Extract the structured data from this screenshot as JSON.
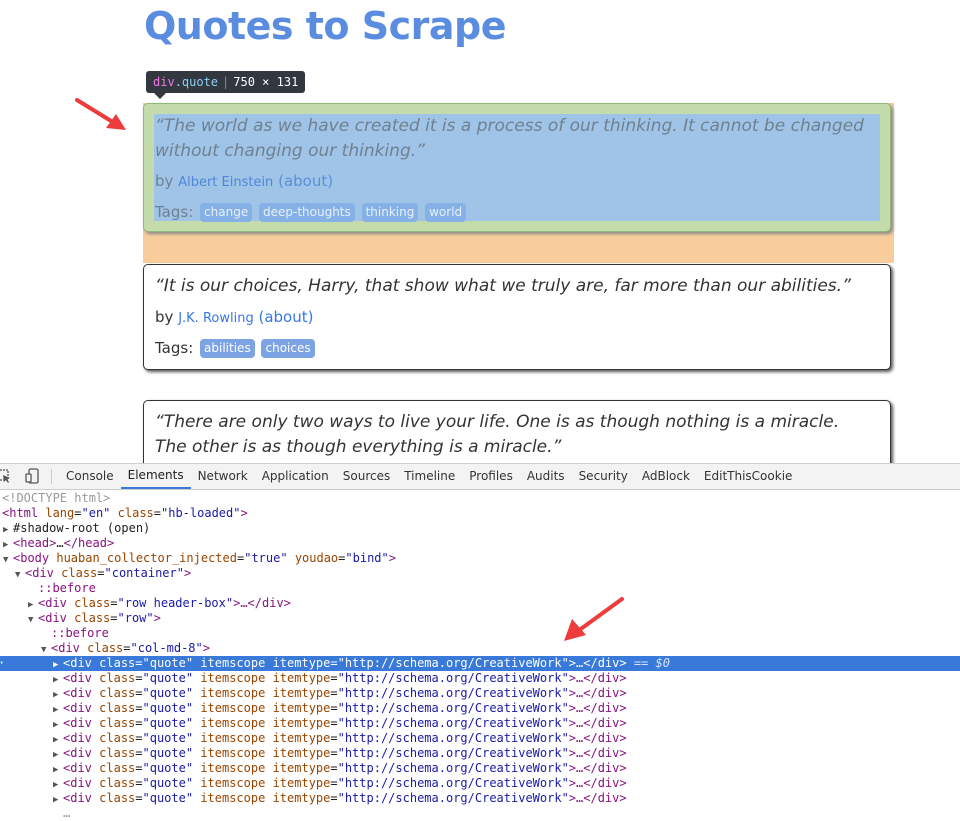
{
  "page": {
    "title": "Quotes to Scrape",
    "inspect_tooltip": {
      "tag": "div",
      "class": ".quote",
      "size": "750 × 131"
    },
    "quotes": [
      {
        "text": "“The world as we have created it is a process of our thinking. It cannot be changed without changing our thinking.”",
        "by": "by",
        "author": "Albert Einstein",
        "about": "(about)",
        "tags_label": "Tags:",
        "tags": [
          "change",
          "deep-thoughts",
          "thinking",
          "world"
        ]
      },
      {
        "text": "“It is our choices, Harry, that show what we truly are, far more than our abilities.”",
        "by": "by",
        "author": "J.K. Rowling",
        "about": "(about)",
        "tags_label": "Tags:",
        "tags": [
          "abilities",
          "choices"
        ]
      },
      {
        "text": "“There are only two ways to live your life. One is as though nothing is a miracle. The other is as though everything is a miracle.”"
      }
    ]
  },
  "devtools": {
    "tabs": [
      "Console",
      "Elements",
      "Network",
      "Application",
      "Sources",
      "Timeline",
      "Profiles",
      "Audits",
      "Security",
      "AdBlock",
      "EditThisCookie"
    ],
    "active_tab": "Elements",
    "dom": {
      "doctype": "<!DOCTYPE html>",
      "html_open": {
        "tag": "<html",
        "a1": "lang",
        "v1": "\"en\"",
        "a2": "class",
        "v2": "\"hb-loaded\"",
        "end": ">"
      },
      "shadow_root": "#shadow-root (open)",
      "head": {
        "open": "<head>",
        "ellipsis": "…",
        "close": "</head>"
      },
      "body_open": {
        "tag": "<body",
        "a1": "huaban_collector_injected",
        "v1": "\"true\"",
        "a2": "youdao",
        "v2": "\"bind\"",
        "end": ">"
      },
      "container": {
        "tag": "<div",
        "a": "class",
        "v": "\"container\"",
        "end": ">"
      },
      "before": "::before",
      "header_row": {
        "tag": "<div",
        "a": "class",
        "v": "\"row header-box\"",
        "end": ">…</div>"
      },
      "row": {
        "tag": "<div",
        "a": "class",
        "v": "\"row\"",
        "end": ">"
      },
      "col": {
        "tag": "<div",
        "a": "class",
        "v": "\"col-md-8\"",
        "end": ">"
      },
      "quote_div": {
        "tag": "<div",
        "a1": "class",
        "v1": "\"quote\"",
        "a2": "itemscope",
        "a3": "itemtype",
        "v3": "\"http://schema.org/CreativeWork\"",
        "end": ">…</div>"
      },
      "selected_marker": "== $0",
      "partial_next": "…"
    }
  }
}
